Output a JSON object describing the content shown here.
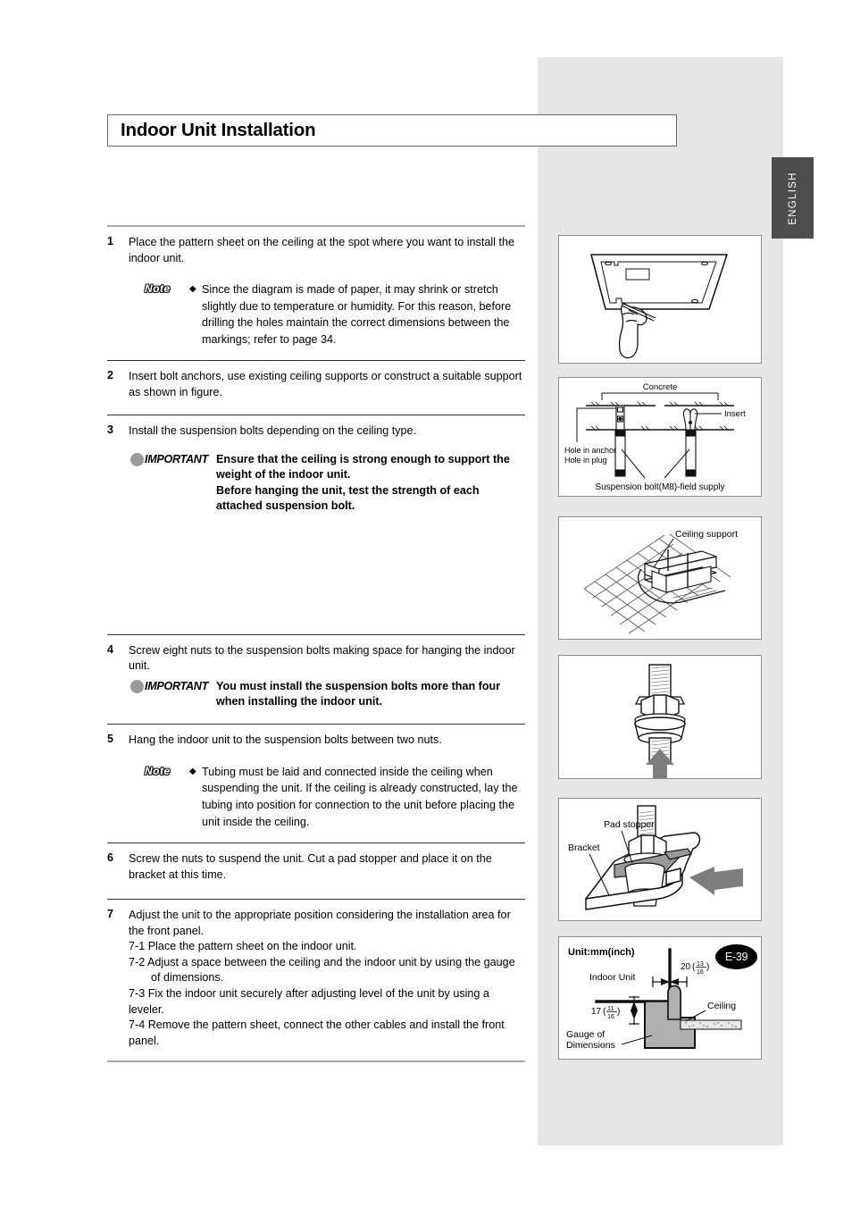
{
  "page": {
    "title": "Indoor Unit Installation",
    "language_tab": "ENGLISH",
    "page_number": "E-39"
  },
  "steps": [
    {
      "num": "1",
      "text": "Place the pattern sheet on the ceiling at the spot where you want to install the indoor unit.",
      "note_label": "Note",
      "note_bullet": "◆",
      "note_text": "Since the diagram is made of paper, it may shrink or stretch slightly due to temperature or humidity. For this reason, before drilling the holes maintain the correct dimensions between the markings; refer to page 34."
    },
    {
      "num": "2",
      "text": "Insert bolt anchors, use existing ceiling supports or construct a suitable support as shown in figure."
    },
    {
      "num": "3",
      "text": "Install the suspension bolts depending on the ceiling type.",
      "important_label_prefix": "IM",
      "important_label_rest": "PORTANT",
      "important_text": "Ensure that the ceiling is strong enough to support the weight of the indoor unit.\nBefore hanging the unit, test the strength of each attached suspension bolt."
    },
    {
      "num": "4",
      "text": "Screw eight nuts to the suspension bolts making space for hanging the indoor unit.",
      "important_label_prefix": "IM",
      "important_label_rest": "PORTANT",
      "important_text": "You must install the suspension bolts more than four when installing the indoor unit."
    },
    {
      "num": "5",
      "text": "Hang the indoor unit to the suspension bolts between two nuts.",
      "note_label": "Note",
      "note_bullet": "◆",
      "note_text": "Tubing must be laid and connected inside the ceiling when suspending the unit. If the ceiling is already constructed, lay the tubing into position for connection to the unit before placing the unit inside the ceiling."
    },
    {
      "num": "6",
      "text": "Screw the nuts to suspend the unit. Cut a pad stopper and place it on the bracket at this time."
    },
    {
      "num": "7",
      "text": "Adjust the unit to the appropriate position considering the installation area for the front panel.",
      "substeps": [
        "7-1 Place the pattern sheet on the indoor unit.",
        "7-2 Adjust a space between the ceiling and the indoor unit by using the gauge",
        "of dimensions.",
        "7-3 Fix the indoor unit securely after adjusting level of the unit by using a leveler.",
        "7-4 Remove the pattern sheet, connect the other cables and install the front panel."
      ]
    }
  ],
  "figures": {
    "fig1": {
      "name": "pattern-sheet-on-ceiling"
    },
    "fig2": {
      "name": "bolt-anchor-concrete",
      "labels": {
        "concrete": "Concrete",
        "insert": "Insert",
        "hole_in_anchor": "Hole in anchor",
        "hole_in_plug": "Hole in plug",
        "suspension_bolt": "Suspension bolt(M8)-field supply"
      }
    },
    "fig3": {
      "name": "ceiling-support",
      "labels": {
        "ceiling_support": "Ceiling support"
      }
    },
    "fig4": {
      "name": "nut-washer-suspension-bolt"
    },
    "fig5": {
      "name": "pad-stopper-bracket",
      "labels": {
        "pad_stopper": "Pad stopper",
        "bracket": "Bracket"
      }
    },
    "fig6": {
      "name": "gauge-of-dimensions",
      "labels": {
        "unit": "Unit:mm(inch)",
        "indoor_unit": "Indoor Unit",
        "ceiling": "Ceiling",
        "gauge_line1": "Gauge of",
        "gauge_line2": "Dimensions",
        "dim_top_whole": "20",
        "dim_top_num": "13",
        "dim_top_den": "16",
        "dim_left_whole": "17",
        "dim_left_num": "11",
        "dim_left_den": "16"
      }
    }
  },
  "colors": {
    "band": "#e6e6e6",
    "tab": "#4d4d4d",
    "figure_border": "#8f8f8f",
    "fill_gray": "#9a9a9a"
  }
}
